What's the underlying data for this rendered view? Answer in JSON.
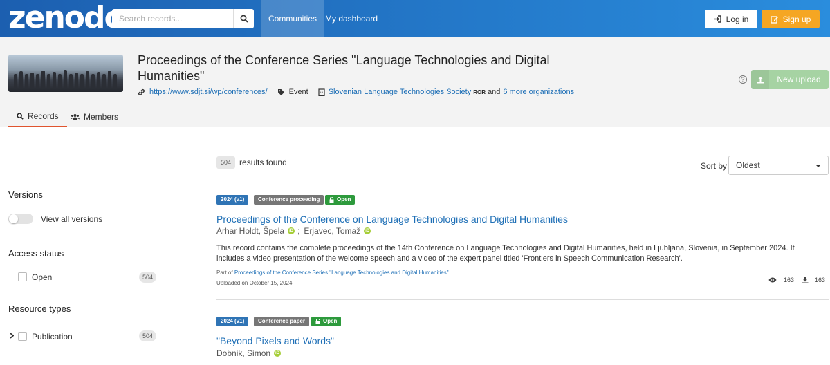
{
  "header": {
    "logo": "zenodo",
    "search_placeholder": "Search records...",
    "nav": [
      "Communities",
      "My dashboard"
    ],
    "login": "Log in",
    "signup": "Sign up"
  },
  "community": {
    "title": "Proceedings of the Conference Series \"Language Technologies and Digital Humanities\"",
    "website": "https://www.sdjt.si/wp/conferences/",
    "type": "Event",
    "organization": "Slovenian Language Technologies Society",
    "ror": "ROR",
    "and": "and",
    "more_orgs": "6 more organizations",
    "new_upload": "New upload",
    "help": "?",
    "tabs": [
      "Records",
      "Members"
    ]
  },
  "results": {
    "count": "504",
    "found_label": "results found",
    "sort_label": "Sort by",
    "sort_value": "Oldest"
  },
  "facets": {
    "versions_title": "Versions",
    "view_all_versions": "View all versions",
    "access_title": "Access status",
    "access_items": [
      {
        "label": "Open",
        "count": "504"
      }
    ],
    "resource_title": "Resource types",
    "resource_items": [
      {
        "label": "Publication",
        "count": "504"
      }
    ]
  },
  "records": [
    {
      "version": "2024 (v1)",
      "type": "Conference proceeding",
      "access": "Open",
      "title": "Proceedings of the Conference on Language Technologies and Digital Humanities",
      "author1": "Arhar Holdt, Špela",
      "sep": ";",
      "author2": "Erjavec, Tomaž",
      "description": "This record contains the complete proceedings of the 14th Conference on Language Technologies and Digital Humanities, held in Ljubljana, Slovenia, in September 2024. It includes a video presentation of the welcome speech and a video of the expert panel titled 'Frontiers in Speech Communication Research'.",
      "part_of_label": "Part of",
      "part_of": "Proceedings of the Conference Series \"Language Technologies and Digital Humanities\"",
      "uploaded": "Uploaded on October 15, 2024",
      "views": "163",
      "downloads": "163"
    },
    {
      "version": "2024 (v1)",
      "type": "Conference paper",
      "access": "Open",
      "title": "\"Beyond Pixels and Words\"",
      "author1": "Dobnik, Simon"
    }
  ],
  "colors": {
    "header_gradient_start": "#1c5fb0",
    "header_gradient_end": "#2a8ddd",
    "signup": "#f5a623",
    "upload": "#a6d3a3",
    "version_badge": "#2f74b5",
    "type_badge": "#767676",
    "open_badge": "#2d9a3c",
    "link": "#1e6fb6",
    "tab_active": "#e0542e",
    "orcid": "#a6ce39"
  }
}
